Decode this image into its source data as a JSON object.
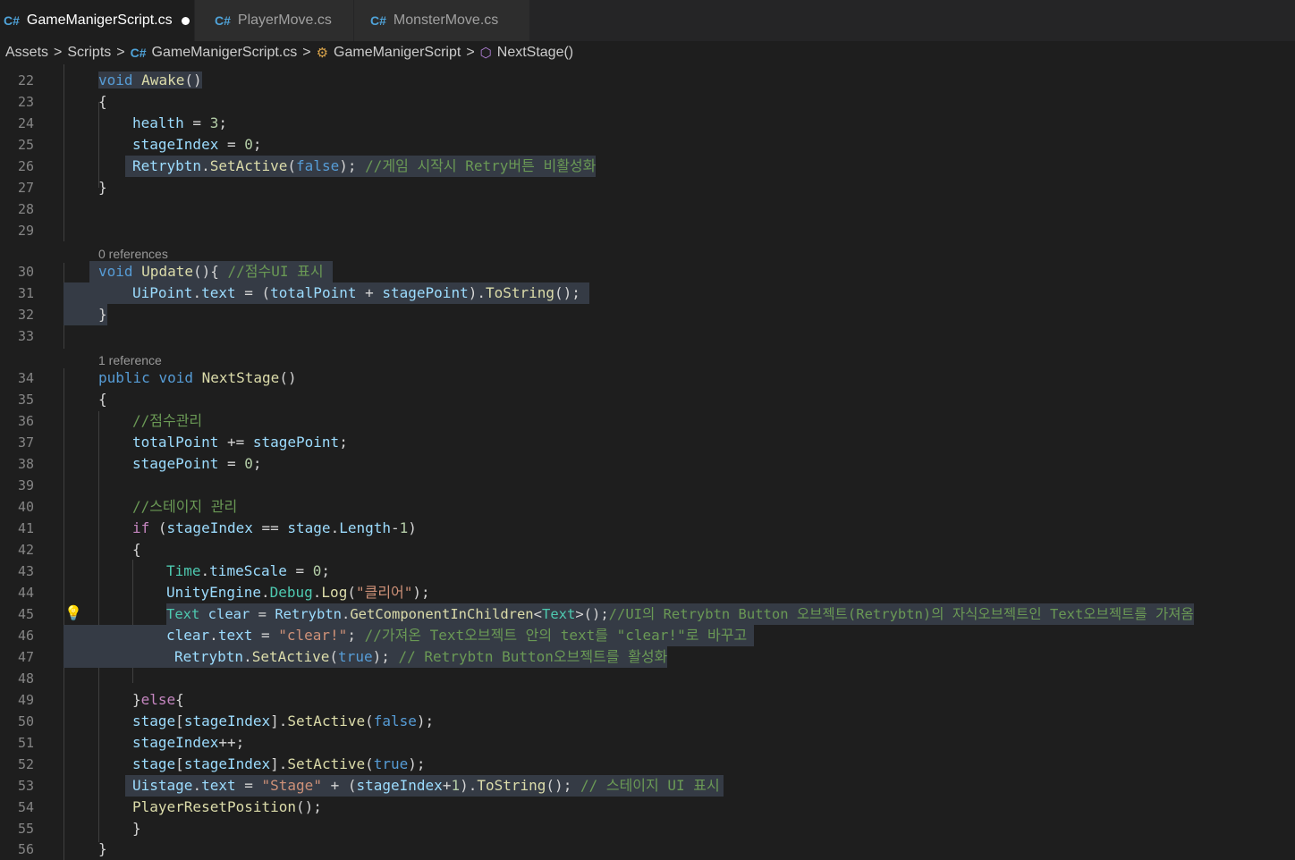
{
  "tabs": [
    {
      "label": "GameManigerScript.cs",
      "active": true,
      "modified": true
    },
    {
      "label": "PlayerMove.cs",
      "active": false
    },
    {
      "label": "MonsterMove.cs",
      "active": false
    }
  ],
  "breadcrumb": [
    "Assets",
    "Scripts",
    "GameManigerScript.cs",
    "GameManigerScript",
    "NextStage()"
  ],
  "lenses": {
    "l21": "0 references",
    "l29": "0 references",
    "l33": "1 reference"
  },
  "lines": {
    "22": "22",
    "23": "23",
    "24": "24",
    "25": "25",
    "26": "26",
    "27": "27",
    "28": "28",
    "29": "29",
    "30": "30",
    "31": "31",
    "32": "32",
    "33": "33",
    "34": "34",
    "35": "35",
    "36": "36",
    "37": "37",
    "38": "38",
    "39": "39",
    "40": "40",
    "41": "41",
    "42": "42",
    "43": "43",
    "44": "44",
    "45": "45",
    "46": "46",
    "47": "47",
    "48": "48",
    "49": "49",
    "50": "50",
    "51": "51",
    "52": "52",
    "53": "53",
    "54": "54",
    "55": "55",
    "56": "56"
  },
  "code": {
    "c22": "void Awake()",
    "c23": "{",
    "c24": "health = 3;",
    "c25": "stageIndex = 0;",
    "c26": "Retrybtn.SetActive(false); //게임 시작시 Retry버튼 비활성화",
    "c27": "}",
    "c30": "void Update(){ //점수UI 표시",
    "c31": "UiPoint.text = (totalPoint + stagePoint).ToString();",
    "c32": "}",
    "c34": "public void NextStage()",
    "c35": "{",
    "c36": "//점수관리",
    "c37": "totalPoint += stagePoint;",
    "c38": "stagePoint = 0;",
    "c40": "//스테이지 관리",
    "c41": "if (stageIndex == stage.Length-1)",
    "c42": "{",
    "c43": "Time.timeScale = 0;",
    "c44": "UnityEngine.Debug.Log(\"클리어\");",
    "c45": "Text clear = Retrybtn.GetComponentInChildren<Text>();//UI의 Retrybtn Button 오브젝트(Retrybtn)의 자식오브젝트인 Text오브젝트를 가져옴",
    "c46": "clear.text = \"clear!\"; //가져온 Text오브젝트 안의 text를 \"clear!\"로 바꾸고",
    "c47": "Retrybtn.SetActive(true); // Retrybtn Button오브젝트를 활성화",
    "c49": "}else{",
    "c50": "stage[stageIndex].SetActive(false);",
    "c51": "stageIndex++;",
    "c52": "stage[stageIndex].SetActive(true);",
    "c53": "Uistage.text = \"Stage\" + (stageIndex+1).ToString(); // 스테이지 UI 표시",
    "c54": "PlayerResetPosition();",
    "c55": "}",
    "c56": "}"
  },
  "icons": {
    "tab_file": "csharp-icon",
    "breadcrumb_class": "class-tree-icon",
    "breadcrumb_method": "method-cube-icon",
    "lightbulb": "lightbulb-icon"
  }
}
